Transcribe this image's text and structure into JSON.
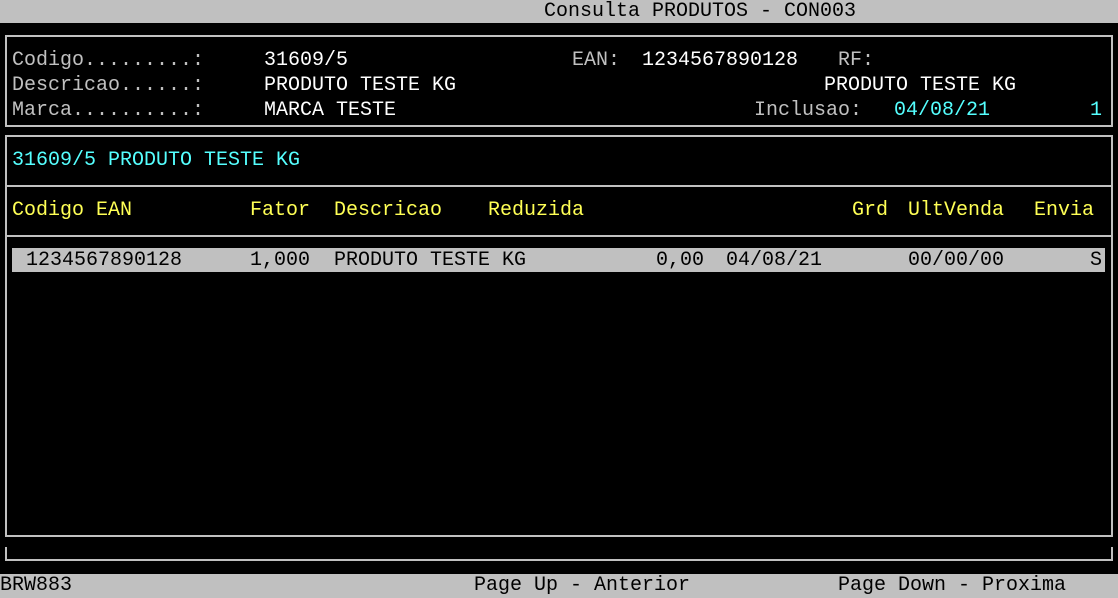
{
  "title": "Consulta PRODUTOS - CON003",
  "header": {
    "codigo_label": "Codigo.........:",
    "codigo_value": "31609/5",
    "ean_label": "EAN:",
    "ean_value": "1234567890128",
    "rf_label": "RF:",
    "descricao_label": "Descricao......:",
    "descricao_value": "PRODUTO TESTE KG",
    "descricao_right": "PRODUTO TESTE KG",
    "marca_label": "Marca..........:",
    "marca_value": "MARCA TESTE",
    "inclusao_label": "Inclusao:",
    "inclusao_value": "04/08/21",
    "inclusao_count": "1"
  },
  "product_line": "31609/5 PRODUTO TESTE KG",
  "table": {
    "columns": {
      "codigo_ean": "Codigo EAN",
      "fator": "Fator",
      "descricao": "Descricao",
      "reduzida": "Reduzida",
      "grd": "Grd",
      "ultvenda": "UltVenda",
      "envia": "Envia"
    },
    "rows": [
      {
        "ean": "1234567890128",
        "fator": "1,000",
        "descricao": "PRODUTO TESTE KG",
        "valor": "0,00",
        "data": "04/08/21",
        "ultvenda": "00/00/00",
        "envia": "S"
      }
    ]
  },
  "footer": {
    "code": "BRW883",
    "page_up": "Page Up - Anterior",
    "page_down": "Page Down - Proxima"
  },
  "colors": {
    "background": "#000000",
    "bar": "#c0c0c0",
    "label": "#c0c0c0",
    "value": "#ffffff",
    "highlight": "#55ffff",
    "column_header": "#ffff55"
  }
}
